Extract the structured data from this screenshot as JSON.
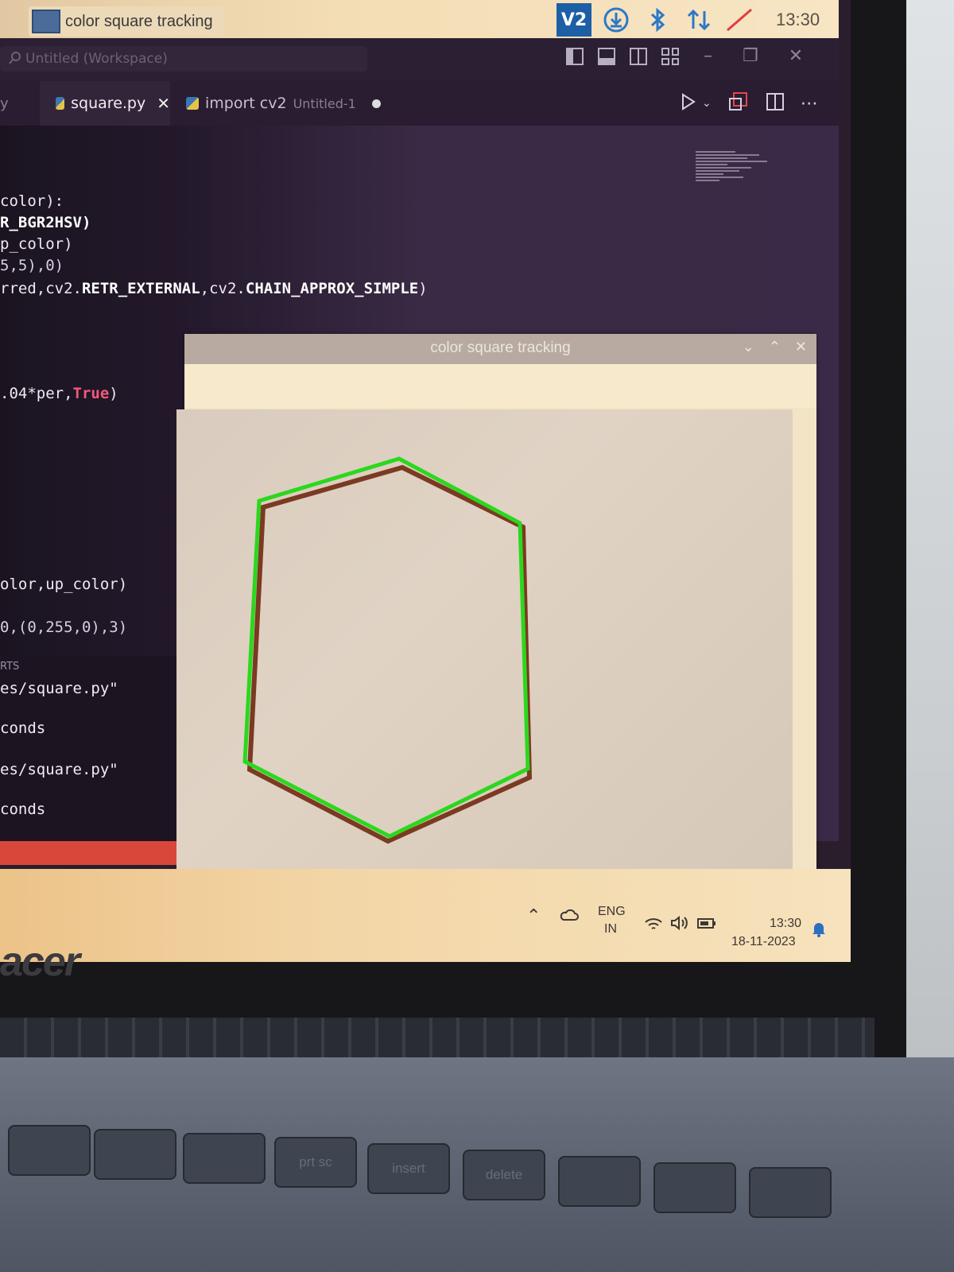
{
  "os_panel": {
    "app_title": "color square tracking",
    "vnc_label": "V2",
    "clock": "13:30"
  },
  "vscode": {
    "search_placeholder": "Untitled (Workspace)",
    "tabs": [
      {
        "label": "square.py"
      },
      {
        "label": "import cv2",
        "sublabel": "Untitled-1"
      }
    ],
    "tab_cut_label": "y",
    "code_lines": [
      {
        "text": "color):"
      },
      {
        "text": "R_BGR2HSV)"
      },
      {
        "text": "p_color)"
      },
      {
        "text": "5,5),0)"
      },
      {
        "pre": "rred,cv2.",
        "kw1": "RETR_EXTERNAL",
        "mid": ",cv2.",
        "kw2": "CHAIN_APPROX_SIMPLE",
        "post": ")"
      },
      {
        "pre": ".04*per,",
        "true": "True",
        "post": ")"
      },
      {
        "text": "olor,up_color)"
      },
      {
        "text": "0,(0,255,0),3)"
      }
    ],
    "terminal": {
      "label": "RTS",
      "lines": [
        "es/square.py\"",
        "conds",
        "es/square.py\"",
        "conds"
      ]
    }
  },
  "cv_window": {
    "title": "color square tracking"
  },
  "taskbar": {
    "lang_top": "ENG",
    "lang_bottom": "IN",
    "time": "13:30",
    "date": "18-11-2023"
  },
  "laptop": {
    "brand": "acer",
    "keys": [
      "prt sc",
      "insert",
      "delete"
    ]
  },
  "colors": {
    "contour": "#2bd81d",
    "statusbar": "#d9473b",
    "vnc": "#1d5fa5"
  }
}
